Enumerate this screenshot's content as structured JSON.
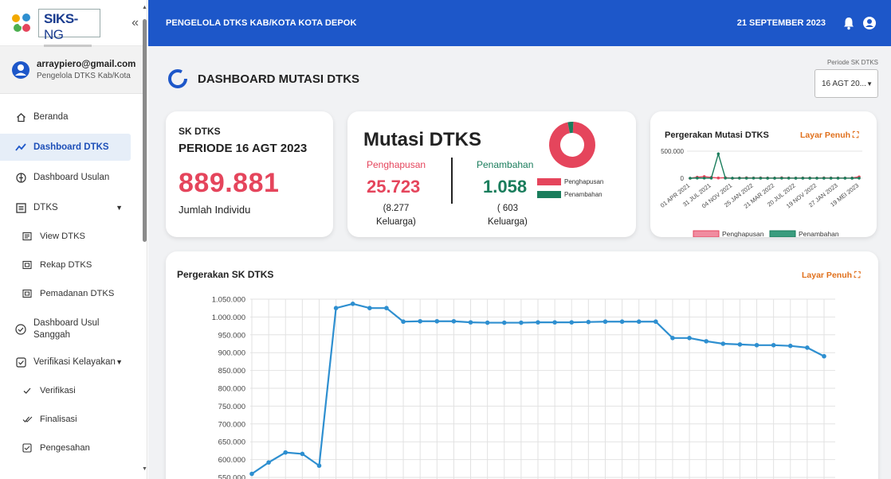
{
  "logo": {
    "brand": "SIKS-",
    "brand_ng": "NG"
  },
  "user": {
    "email": "arraypiero@gmail.com",
    "role": "Pengelola DTKS Kab/Kota"
  },
  "sidebar": {
    "items": [
      {
        "label": "Beranda",
        "icon": "home-icon"
      },
      {
        "label": "Dashboard DTKS",
        "icon": "trend-icon"
      },
      {
        "label": "Dashboard Usulan",
        "icon": "add-circle-icon"
      },
      {
        "label": "DTKS",
        "icon": "list-box-icon"
      },
      {
        "label": "View DTKS",
        "icon": "doc-icon"
      },
      {
        "label": "Rekap DTKS",
        "icon": "doc-icon"
      },
      {
        "label": "Pemadanan DTKS",
        "icon": "doc-icon"
      },
      {
        "label": "Dashboard Usul Sanggah",
        "icon": "check-circle-icon"
      },
      {
        "label": "Verifikasi Kelayakan",
        "icon": "shield-icon"
      },
      {
        "label": "Verifikasi",
        "icon": "check-icon"
      },
      {
        "label": "Finalisasi",
        "icon": "double-check-icon"
      },
      {
        "label": "Pengesahan",
        "icon": "check-box-icon"
      }
    ]
  },
  "topbar": {
    "title": "PENGELOLA DTKS KAB/KOTA KOTA DEPOK",
    "date": "21 SEPTEMBER 2023"
  },
  "page": {
    "title": "DASHBOARD MUTASI DTKS"
  },
  "period": {
    "label": "Periode SK DTKS",
    "value": "16 AGT 20..."
  },
  "sk_card": {
    "label": "SK DTKS",
    "period": "PERIODE 16 AGT 2023",
    "value": "889.881",
    "desc": "Jumlah Individu"
  },
  "mutasi_card": {
    "title": "Mutasi DTKS",
    "penghapusan_label": "Penghapusan",
    "penghapusan_value": "25.723",
    "penghapusan_fam_1": "(8.277",
    "penghapusan_fam_2": "Keluarga)",
    "penambahan_label": "Penambahan",
    "penambahan_value": "1.058",
    "penambahan_fam_1": "( 603",
    "penambahan_fam_2": "Keluarga)",
    "legend_hapus": "Penghapusan",
    "legend_tambah": "Penambahan"
  },
  "gerak_card": {
    "title": "Pergerakan Mutasi DTKS",
    "fullscreen": "Layar Penuh"
  },
  "sk_chart_card": {
    "title": "Pergerakan SK DTKS",
    "fullscreen": "Layar Penuh"
  },
  "colors": {
    "primary": "#1d57c9",
    "red": "#e5455c",
    "green": "#1a7d5c",
    "line": "#2e8fd0",
    "orange": "#e0701c"
  },
  "chart_data": [
    {
      "type": "pie",
      "title": "",
      "categories": [
        "Penghapusan",
        "Penambahan"
      ],
      "values": [
        25723,
        1058
      ],
      "colors": [
        "#e5455c",
        "#1a7d5c"
      ]
    },
    {
      "type": "line",
      "title": "Pergerakan Mutasi DTKS",
      "x_ticks": [
        "01 APR 2021",
        "31 JUL 2021",
        "04 NOV 2021",
        "25 JAN 2022",
        "21 MAR 2022",
        "20 JUL 2022",
        "19 NOV 2022",
        "27 JAN 2023",
        "19 MEI 2023"
      ],
      "y_ticks": [
        "0",
        "500.000"
      ],
      "ylim": [
        0,
        500000
      ],
      "series": [
        {
          "name": "Penghapusan",
          "values": [
            0,
            20000,
            30000,
            15000,
            5000,
            10000,
            0,
            5000,
            8000,
            5000,
            6000,
            4000,
            3000,
            8000,
            5000,
            3000,
            4000,
            5000,
            3000,
            6000,
            4000,
            5000,
            3000,
            4000,
            25723
          ]
        },
        {
          "name": "Penambahan",
          "values": [
            0,
            3000,
            2000,
            1000,
            450000,
            2000,
            1000,
            1000,
            1500,
            1000,
            800,
            900,
            700,
            1200,
            1000,
            900,
            800,
            700,
            600,
            700,
            900,
            800,
            600,
            700,
            1058
          ]
        }
      ]
    },
    {
      "type": "line",
      "title": "Pergerakan SK DTKS",
      "y_ticks": [
        "550.000",
        "600.000",
        "650.000",
        "700.000",
        "750.000",
        "800.000",
        "850.000",
        "900.000",
        "950.000",
        "1.000.000",
        "1.050.000"
      ],
      "ylim": [
        550000,
        1050000
      ],
      "series": [
        {
          "name": "SK DTKS",
          "values": [
            560000,
            592000,
            620000,
            616000,
            583000,
            1025000,
            1037000,
            1025000,
            1025000,
            987000,
            988000,
            988000,
            988000,
            985000,
            984000,
            984000,
            984000,
            985000,
            985000,
            985000,
            986000,
            987000,
            987000,
            987000,
            987000,
            941000,
            941000,
            932000,
            925000,
            923000,
            921000,
            921000,
            919000,
            914000,
            889881
          ]
        }
      ]
    }
  ]
}
